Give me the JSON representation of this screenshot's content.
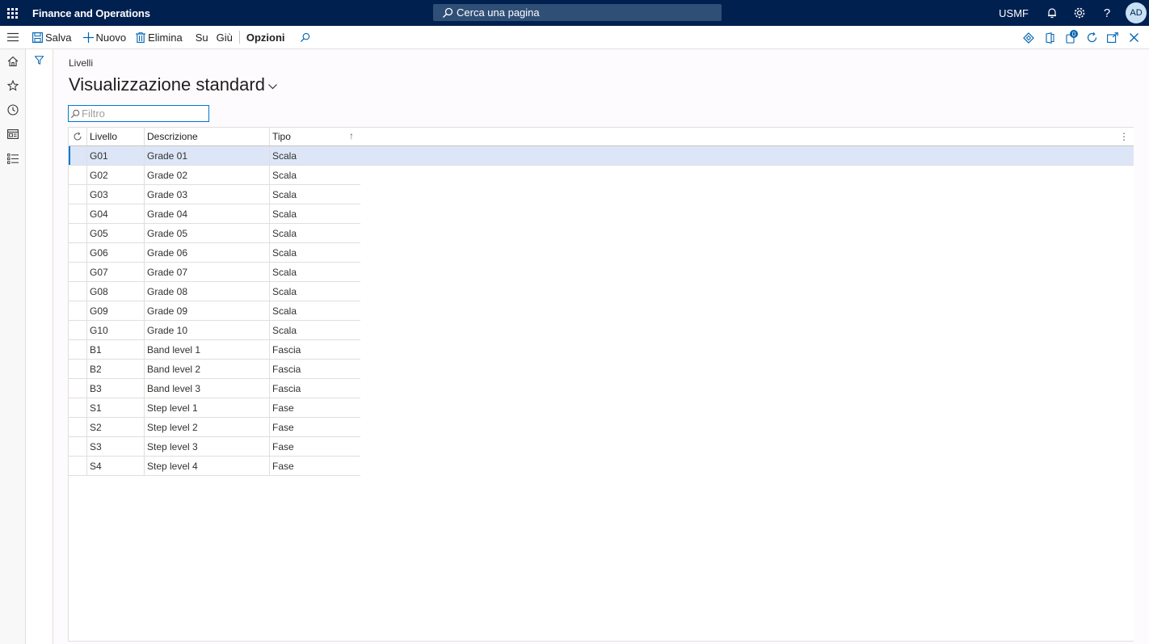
{
  "app": {
    "title": "Finance and Operations",
    "search_placeholder": "Cerca una pagina",
    "company": "USMF",
    "avatar_initials": "AD"
  },
  "actions": {
    "save": "Salva",
    "new": "Nuovo",
    "delete": "Elimina",
    "up": "Su",
    "down": "Giù",
    "options": "Opzioni",
    "notification_count": "0"
  },
  "page": {
    "breadcrumb": "Livelli",
    "view_title": "Visualizzazione standard",
    "filter_placeholder": "Filtro"
  },
  "grid": {
    "columns": [
      "Livello",
      "Descrizione",
      "Tipo"
    ],
    "sort_indicator": "↑",
    "rows": [
      {
        "livello": "G01",
        "descrizione": "Grade 01",
        "tipo": "Scala"
      },
      {
        "livello": "G02",
        "descrizione": "Grade 02",
        "tipo": "Scala"
      },
      {
        "livello": "G03",
        "descrizione": "Grade 03",
        "tipo": "Scala"
      },
      {
        "livello": "G04",
        "descrizione": "Grade 04",
        "tipo": "Scala"
      },
      {
        "livello": "G05",
        "descrizione": "Grade 05",
        "tipo": "Scala"
      },
      {
        "livello": "G06",
        "descrizione": "Grade 06",
        "tipo": "Scala"
      },
      {
        "livello": "G07",
        "descrizione": "Grade 07",
        "tipo": "Scala"
      },
      {
        "livello": "G08",
        "descrizione": "Grade 08",
        "tipo": "Scala"
      },
      {
        "livello": "G09",
        "descrizione": "Grade 09",
        "tipo": "Scala"
      },
      {
        "livello": "G10",
        "descrizione": "Grade 10",
        "tipo": "Scala"
      },
      {
        "livello": "B1",
        "descrizione": "Band level 1",
        "tipo": "Fascia"
      },
      {
        "livello": "B2",
        "descrizione": "Band level 2",
        "tipo": "Fascia"
      },
      {
        "livello": "B3",
        "descrizione": "Band level 3",
        "tipo": "Fascia"
      },
      {
        "livello": "S1",
        "descrizione": "Step level 1",
        "tipo": "Fase"
      },
      {
        "livello": "S2",
        "descrizione": "Step level 2",
        "tipo": "Fase"
      },
      {
        "livello": "S3",
        "descrizione": "Step level 3",
        "tipo": "Fase"
      },
      {
        "livello": "S4",
        "descrizione": "Step level 4",
        "tipo": "Fase"
      }
    ],
    "selected_row": 0
  },
  "colors": {
    "topbar": "#002050",
    "accent": "#0078d4",
    "selected_row": "#dce6f7"
  }
}
